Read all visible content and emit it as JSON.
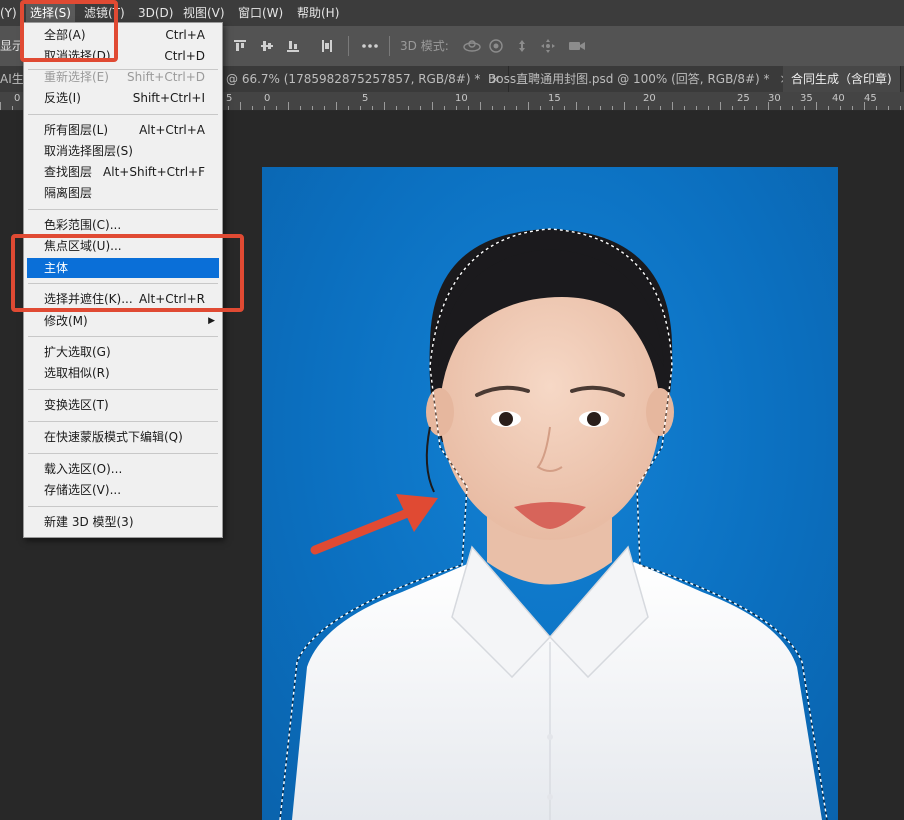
{
  "menubar": {
    "items": [
      "(Y)",
      "选择(S)",
      "滤镜(T)",
      "3D(D)",
      "视图(V)",
      "窗口(W)",
      "帮助(H)"
    ]
  },
  "options": {
    "show_label": "显示",
    "mode3d_label": "3D 模式:"
  },
  "tabs": [
    {
      "label": "AI生",
      "active": false
    },
    {
      "label": "@ 66.7% (1785982875257857, RGB/8#) *",
      "active": false,
      "close": "×"
    },
    {
      "label": "Boss直聘通用封图.psd @ 100% (回答, RGB/8#) *",
      "active": false,
      "close": "×"
    },
    {
      "label": "合同生成（含印章)",
      "active": true
    }
  ],
  "ruler": {
    "labels": [
      "0",
      "5",
      "0",
      "5",
      "10",
      "15",
      "20",
      "25",
      "30",
      "35",
      "40",
      "45"
    ]
  },
  "select_menu": {
    "items": [
      {
        "label": "全部(A)",
        "shortcut": "Ctrl+A",
        "state": "normal"
      },
      {
        "label": "取消选择(D)",
        "shortcut": "Ctrl+D",
        "state": "normal"
      },
      {
        "label": "重新选择(E)",
        "shortcut": "Shift+Ctrl+D",
        "state": "disabled"
      },
      {
        "label": "反选(I)",
        "shortcut": "Shift+Ctrl+I",
        "state": "normal"
      },
      {
        "label": "所有图层(L)",
        "shortcut": "Alt+Ctrl+A",
        "state": "normal"
      },
      {
        "label": "取消选择图层(S)",
        "shortcut": "",
        "state": "normal"
      },
      {
        "label": "查找图层",
        "shortcut": "Alt+Shift+Ctrl+F",
        "state": "normal"
      },
      {
        "label": "隔离图层",
        "shortcut": "",
        "state": "normal"
      },
      {
        "label": "色彩范围(C)...",
        "shortcut": "",
        "state": "normal"
      },
      {
        "label": "焦点区域(U)...",
        "shortcut": "",
        "state": "normal"
      },
      {
        "label": "主体",
        "shortcut": "",
        "state": "selected"
      },
      {
        "label": "选择并遮住(K)...",
        "shortcut": "Alt+Ctrl+R",
        "state": "normal"
      },
      {
        "label": "修改(M)",
        "shortcut": "",
        "state": "submenu"
      },
      {
        "label": "扩大选取(G)",
        "shortcut": "",
        "state": "normal"
      },
      {
        "label": "选取相似(R)",
        "shortcut": "",
        "state": "normal"
      },
      {
        "label": "变换选区(T)",
        "shortcut": "",
        "state": "normal"
      },
      {
        "label": "在快速蒙版模式下编辑(Q)",
        "shortcut": "",
        "state": "normal"
      },
      {
        "label": "载入选区(O)...",
        "shortcut": "",
        "state": "normal"
      },
      {
        "label": "存储选区(V)...",
        "shortcut": "",
        "state": "normal"
      },
      {
        "label": "新建 3D 模型(3)",
        "shortcut": "",
        "state": "normal"
      }
    ]
  },
  "colors": {
    "annotation": "#e04a33",
    "highlight": "#0a6fd8",
    "photo_bg": "#0b6fbf"
  }
}
